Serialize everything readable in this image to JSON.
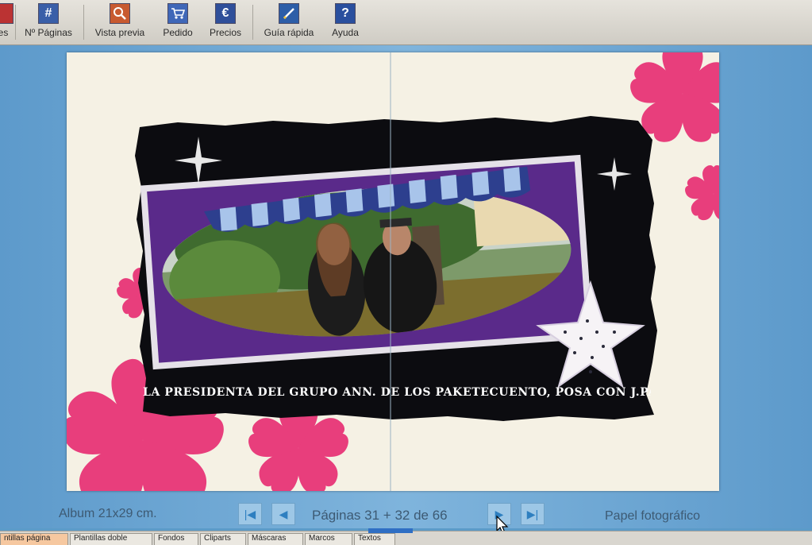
{
  "toolbar": {
    "items": [
      {
        "label": "es",
        "icon": "pages-icon"
      },
      {
        "label": "Nº Páginas",
        "icon": "hash-icon"
      },
      {
        "label": "Vista previa",
        "icon": "preview-icon"
      },
      {
        "label": "Pedido",
        "icon": "cart-icon"
      },
      {
        "label": "Precios",
        "icon": "euro-icon"
      },
      {
        "label": "Guía rápida",
        "icon": "pen-icon"
      },
      {
        "label": "Ayuda",
        "icon": "help-icon"
      }
    ]
  },
  "page": {
    "caption": "LA PRESIDENTA DEL GRUPO ANN. DE LOS PAKETECUENTO, POSA CON J.PALACINO",
    "colors": {
      "flower": "#e83e7c",
      "frame_black": "#0c0c10",
      "frame_purple": "#5a2a8a",
      "cream": "#f5f1e4"
    }
  },
  "status": {
    "album_size": "Album 21x29 cm.",
    "pages": "Páginas 31 + 32 de 66",
    "paper": "Papel fotográfico"
  },
  "tabs": [
    {
      "label": "ntillas página"
    },
    {
      "label": "Plantillas doble"
    },
    {
      "label": "Fondos"
    },
    {
      "label": "Cliparts"
    },
    {
      "label": "Máscaras"
    },
    {
      "label": "Marcos"
    },
    {
      "label": "Textos"
    }
  ]
}
